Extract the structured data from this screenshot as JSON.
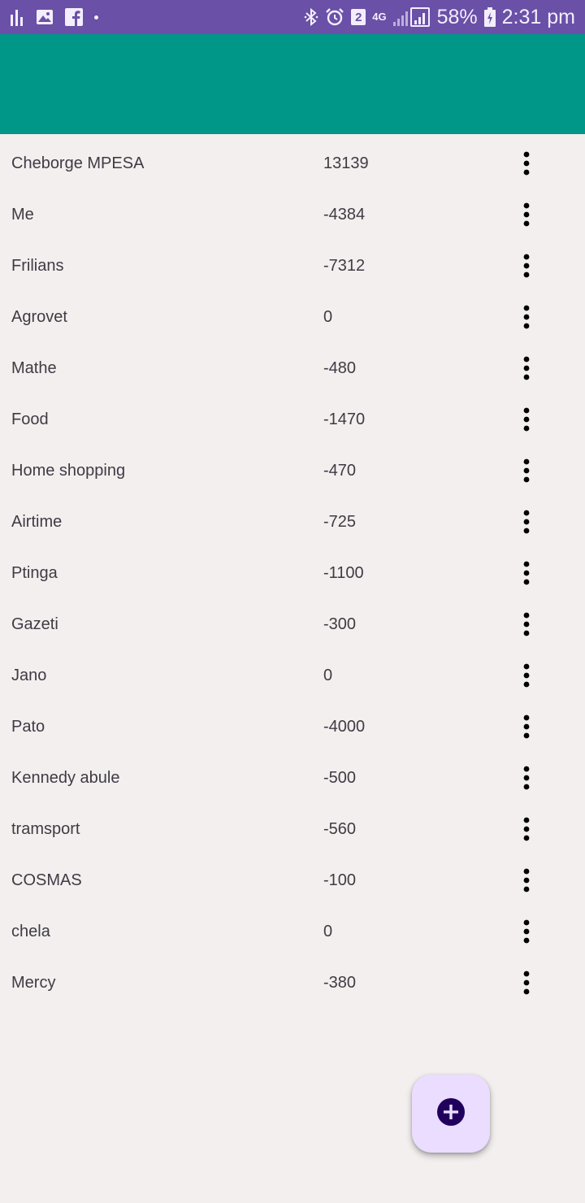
{
  "status_bar": {
    "battery": "58%",
    "time": "2:31 pm",
    "notification_badge": "2",
    "network": "4G",
    "icons": [
      "bar-chart-icon",
      "image-icon",
      "facebook-icon",
      "dot-icon",
      "bluetooth-icon",
      "alarm-icon",
      "signal-icon",
      "battery-charging-icon"
    ]
  },
  "colors": {
    "status_bar": "#6a50a7",
    "app_bar": "#009688",
    "background": "#f2efee",
    "fab": "#eaddff",
    "fab_icon": "#21005d"
  },
  "accounts": [
    {
      "name": "Cheborge MPESA",
      "value": "13139"
    },
    {
      "name": "Me",
      "value": "-4384"
    },
    {
      "name": "Frilians",
      "value": "-7312"
    },
    {
      "name": "Agrovet",
      "value": "0"
    },
    {
      "name": "Mathe",
      "value": "-480"
    },
    {
      "name": "Food",
      "value": "-1470"
    },
    {
      "name": "Home shopping",
      "value": "-470"
    },
    {
      "name": "Airtime",
      "value": "-725"
    },
    {
      "name": "Ptinga",
      "value": "-1100"
    },
    {
      "name": "Gazeti",
      "value": "-300"
    },
    {
      "name": "Jano",
      "value": "0"
    },
    {
      "name": "Pato",
      "value": "-4000"
    },
    {
      "name": "Kennedy abule",
      "value": "-500"
    },
    {
      "name": "tramsport",
      "value": "-560"
    },
    {
      "name": "COSMAS",
      "value": "-100"
    },
    {
      "name": "chela",
      "value": "0"
    },
    {
      "name": "Mercy",
      "value": "-380"
    }
  ],
  "row_menu_icon": "more-vert-icon",
  "fab": {
    "icon": "add-circle-icon"
  }
}
